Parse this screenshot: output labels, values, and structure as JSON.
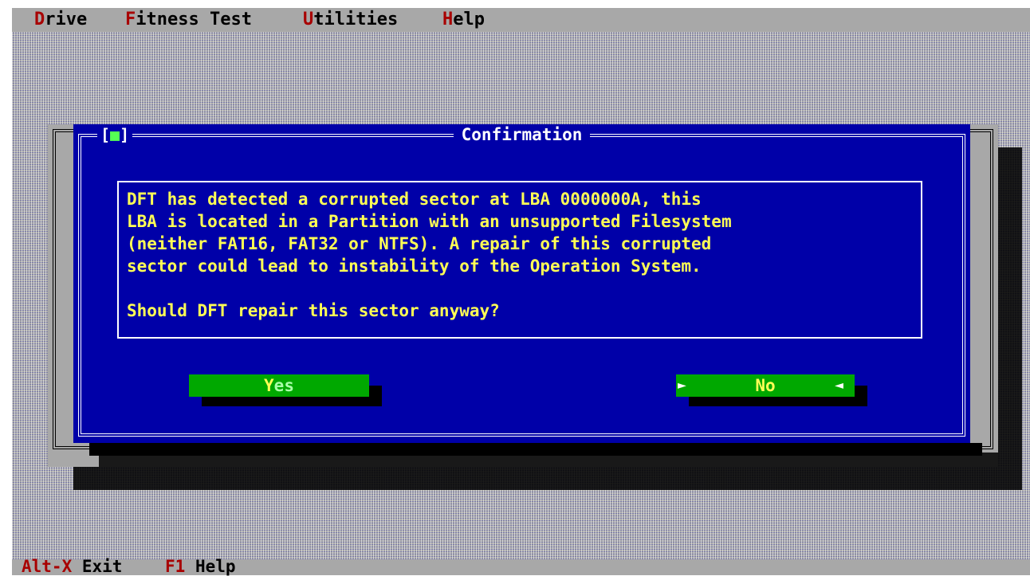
{
  "menu": {
    "items": [
      {
        "hot": "D",
        "rest": "rive"
      },
      {
        "hot": "F",
        "rest": "itness Test"
      },
      {
        "hot": "U",
        "rest": "tilities"
      },
      {
        "hot": "H",
        "rest": "elp"
      }
    ]
  },
  "dialog": {
    "close_box": {
      "left": "[",
      "dot": "■",
      "right": "]"
    },
    "title": "Confirmation",
    "message_lines": [
      "DFT has detected a corrupted sector at LBA 0000000A, this",
      "LBA is located in a Partition with an unsupported Filesystem",
      "(neither FAT16, FAT32 or NTFS). A repair of this corrupted",
      "sector could lead to instability of the Operation System.",
      "",
      "Should DFT repair this sector anyway?"
    ],
    "buttons": {
      "yes": {
        "hot": "Y",
        "rest": "es"
      },
      "no": {
        "label": "No",
        "mark_left": "►",
        "mark_right": "◄"
      }
    }
  },
  "status_bar": {
    "items": [
      {
        "key": "Alt-X",
        "label": "Exit"
      },
      {
        "key": "F1",
        "label": "Help"
      }
    ]
  },
  "colors": {
    "dialog_background": "#0000a8",
    "message_text": "#ffff55",
    "button_background": "#00a800",
    "hotkey": "#a80000",
    "desktop": "#a8a8a8"
  }
}
